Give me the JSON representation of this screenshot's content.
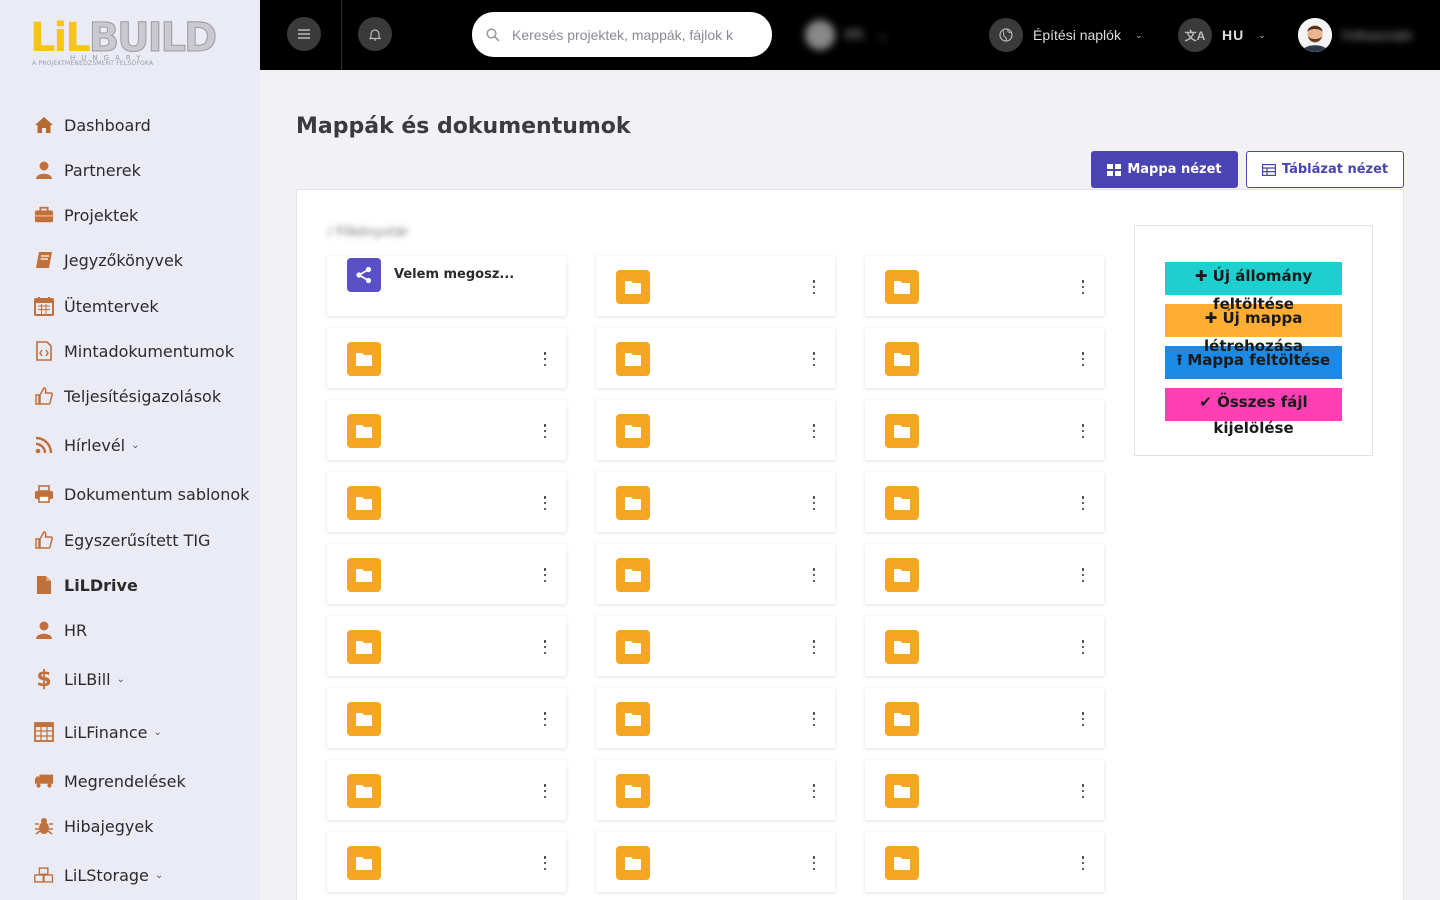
{
  "sidebar": {
    "logo": {
      "main": "LiLBUILD",
      "country": "HUNGARY",
      "tagline": "A PROJEKTMENEDZSMENT FELSŐFOKA"
    },
    "items": [
      {
        "label": "Dashboard",
        "icon": "home-icon"
      },
      {
        "label": "Partnerek",
        "icon": "user-icon"
      },
      {
        "label": "Projektek",
        "icon": "briefcase-icon"
      },
      {
        "label": "Jegyzőkönyvek",
        "icon": "book-icon"
      },
      {
        "label": "Ütemtervek",
        "icon": "calendar-icon"
      },
      {
        "label": "Mintadokumentumok",
        "icon": "code-file-icon"
      },
      {
        "label": "Teljesítésigazolások",
        "icon": "thumbs-up-icon"
      },
      {
        "label": "Hírlevél",
        "icon": "rss-icon",
        "dropdown": true
      },
      {
        "label": "Dokumentum sablonok",
        "icon": "printer-icon"
      },
      {
        "label": "Egyszerűsített TIG",
        "icon": "thumbs-up-icon"
      },
      {
        "label": "LiLDrive",
        "icon": "file-icon",
        "active": true
      },
      {
        "label": "HR",
        "icon": "user-icon"
      },
      {
        "label": "LiLBill",
        "icon": "dollar-icon",
        "dropdown": true
      },
      {
        "label": "LiLFinance",
        "icon": "calculator-icon",
        "dropdown": true
      },
      {
        "label": "Megrendelések",
        "icon": "truck-icon"
      },
      {
        "label": "Hibajegyek",
        "icon": "bug-icon"
      },
      {
        "label": "LiLStorage",
        "icon": "boxes-icon",
        "dropdown": true
      }
    ]
  },
  "topbar": {
    "search_placeholder": "Keresés projektek, mappák, fájlok k",
    "company_blurred": "Kft.",
    "diary_label": "Építési naplók",
    "language": "HU",
    "user_blurred": "Felhasználó"
  },
  "main": {
    "title": "Mappák és dokumentumok",
    "folder_view_label": "Mappa nézet",
    "table_view_label": "Táblázat nézet",
    "breadcrumb": "/ Főkönyvtár",
    "shared_card_label": "Velem megosz...",
    "folder_count": 26
  },
  "actions": {
    "new_file": "Új állomány feltöltése",
    "new_folder": "Új mappa létrehozása",
    "upload_folder": "Mappa feltöltése",
    "select_all_line1": "Összes fájl",
    "select_all_line2": "kijelölése"
  },
  "colors": {
    "primary": "#4a43b3",
    "folder": "#f5a623",
    "new_file": "#1ecfcf",
    "new_folder": "#ffae33",
    "upload_folder": "#1e88e5",
    "select_all": "#ff3fb4"
  }
}
